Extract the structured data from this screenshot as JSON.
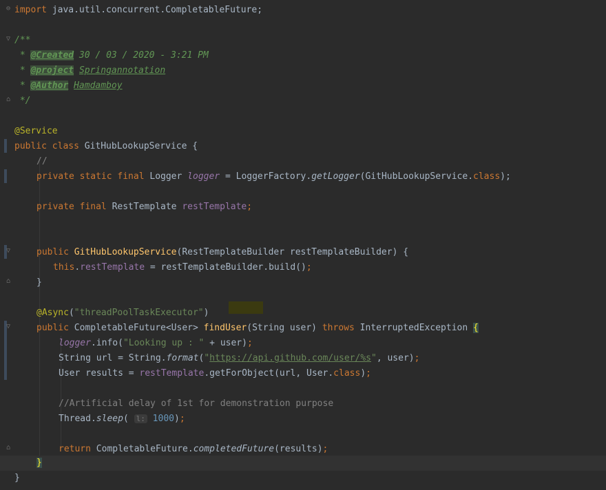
{
  "editor": {
    "lines": [
      {
        "id": "l1",
        "parts": [
          [
            "kw",
            "import"
          ],
          [
            "plain",
            " java.util.concurrent.CompletableFuture;"
          ]
        ]
      },
      {
        "id": "l2",
        "parts": [
          [
            "doc",
            "/**"
          ]
        ]
      },
      {
        "id": "l3",
        "parts": [
          [
            "doc",
            " * "
          ],
          [
            "tag",
            "@Created"
          ],
          [
            "doc",
            " 30 / 03 / 2020 - 3:21 PM"
          ]
        ]
      },
      {
        "id": "l4",
        "parts": [
          [
            "doc",
            " * "
          ],
          [
            "tag",
            "@project"
          ],
          [
            "doc",
            " "
          ],
          [
            "docval",
            "Springannotation"
          ]
        ]
      },
      {
        "id": "l5",
        "parts": [
          [
            "doc",
            " * "
          ],
          [
            "tag",
            "@Author"
          ],
          [
            "doc",
            " "
          ],
          [
            "docval",
            "Hamdamboy"
          ]
        ]
      },
      {
        "id": "l6",
        "parts": [
          [
            "doc",
            " */"
          ]
        ]
      },
      {
        "id": "l7",
        "parts": [
          [
            "ann",
            "@Service"
          ]
        ]
      },
      {
        "id": "l8",
        "parts": [
          [
            "kw",
            "public class "
          ],
          [
            "plain",
            "GitHubLookupService {"
          ]
        ]
      },
      {
        "id": "l9",
        "parts": [
          [
            "cmt",
            "//"
          ]
        ]
      },
      {
        "id": "l10",
        "parts": [
          [
            "kw",
            "private static final "
          ],
          [
            "plain",
            "Logger "
          ],
          [
            "fieldi",
            "logger"
          ],
          [
            "plain",
            " = LoggerFactory."
          ],
          [
            "ital",
            "getLogger"
          ],
          [
            "plain",
            "(GitHubLookupService."
          ],
          [
            "kw",
            "class"
          ],
          [
            "plain",
            ");"
          ]
        ]
      },
      {
        "id": "l11",
        "parts": [
          [
            "kw",
            "private final "
          ],
          [
            "plain",
            "RestTemplate "
          ],
          [
            "field",
            "restTemplate"
          ],
          [
            "kw",
            ";"
          ]
        ]
      },
      {
        "id": "l12",
        "parts": [
          [
            "kw",
            "public "
          ],
          [
            "fn",
            "GitHubLookupService"
          ],
          [
            "plain",
            "(RestTemplateBuilder restTemplateBuilder) {"
          ]
        ]
      },
      {
        "id": "l13",
        "parts": [
          [
            "kw",
            "this"
          ],
          [
            "plain",
            "."
          ],
          [
            "field",
            "restTemplate"
          ],
          [
            "plain",
            " = restTemplateBuilder.build()"
          ],
          [
            "kw",
            ";"
          ]
        ]
      },
      {
        "id": "l14",
        "parts": [
          [
            "plain",
            "}"
          ]
        ]
      },
      {
        "id": "l15",
        "parts": [
          [
            "ann",
            "@Async"
          ],
          [
            "plain",
            "("
          ],
          [
            "str",
            "\"threadPoolTaskExecutor\""
          ],
          [
            "plain",
            ")"
          ]
        ]
      },
      {
        "id": "l16",
        "parts": [
          [
            "kw",
            "public "
          ],
          [
            "plain",
            "CompletableFuture<User> "
          ],
          [
            "fn",
            "findUser"
          ],
          [
            "plain",
            "(String user) "
          ],
          [
            "kw",
            "throws "
          ],
          [
            "plain",
            "InterruptedException "
          ],
          [
            "brace",
            "{"
          ]
        ]
      },
      {
        "id": "l17",
        "parts": [
          [
            "fieldi",
            "logger"
          ],
          [
            "plain",
            ".info("
          ],
          [
            "str",
            "\"Looking up : \""
          ],
          [
            "plain",
            " + user)"
          ],
          [
            "kw",
            ";"
          ]
        ]
      },
      {
        "id": "l18",
        "parts": [
          [
            "plain",
            "String url = String."
          ],
          [
            "ital",
            "format"
          ],
          [
            "plain",
            "("
          ],
          [
            "str",
            "\""
          ],
          [
            "link",
            "https://api.github.com/user/%s"
          ],
          [
            "str",
            "\""
          ],
          [
            "plain",
            ", user)"
          ],
          [
            "kw",
            ";"
          ]
        ]
      },
      {
        "id": "l19",
        "parts": [
          [
            "plain",
            "User results = "
          ],
          [
            "field",
            "restTemplate"
          ],
          [
            "plain",
            ".getForObject(url, User."
          ],
          [
            "kw",
            "class"
          ],
          [
            "plain",
            ")"
          ],
          [
            "kw",
            ";"
          ]
        ]
      },
      {
        "id": "l20",
        "parts": [
          [
            "cmt",
            "//Artificial delay of 1st for demonstration purpose"
          ]
        ]
      },
      {
        "id": "l21",
        "parts": [
          [
            "plain",
            "Thread."
          ],
          [
            "ital",
            "sleep"
          ],
          [
            "plain",
            "( "
          ],
          [
            "hint",
            "l:"
          ],
          [
            "plain",
            " "
          ],
          [
            "num",
            "1000"
          ],
          [
            "plain",
            ")"
          ],
          [
            "kw",
            ";"
          ]
        ]
      },
      {
        "id": "l22",
        "parts": [
          [
            "kw",
            "return "
          ],
          [
            "plain",
            "CompletableFuture."
          ],
          [
            "ital",
            "completedFuture"
          ],
          [
            "plain",
            "(results)"
          ],
          [
            "kw",
            ";"
          ]
        ]
      },
      {
        "id": "l23",
        "parts": [
          [
            "brace",
            "}"
          ]
        ]
      },
      {
        "id": "l24",
        "parts": [
          [
            "plain",
            "}"
          ]
        ]
      }
    ]
  }
}
